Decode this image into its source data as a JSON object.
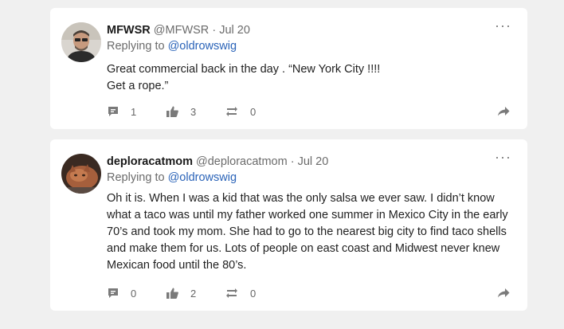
{
  "posts": [
    {
      "author": "MFWSR",
      "handle": "@MFWSR",
      "date": "Jul 20",
      "reply_prefix": "Replying to",
      "reply_to": "@oldrowswig",
      "body": [
        "Great commercial back in the day . “New York City !!!!",
        "Get a rope.”"
      ],
      "comments": "1",
      "likes": "3",
      "reposts": "0"
    },
    {
      "author": "deploracatmom",
      "handle": "@deploracatmom",
      "date": "Jul 20",
      "reply_prefix": "Replying to",
      "reply_to": "@oldrowswig",
      "body": [
        "Oh it is. When I was a kid that was the only salsa we ever saw. I didn’t know what a taco was until my father worked one summer in Mexico City in the early 70’s and took my mom. She had to go to the nearest big city to find taco shells and make them for us. Lots of people on east coast and Midwest never knew  Mexican food until the 80’s."
      ],
      "comments": "0",
      "likes": "2",
      "reposts": "0"
    }
  ],
  "separator": "·",
  "more_glyph": "···",
  "icons": {
    "comment": "comment-icon",
    "like": "thumbs-up-icon",
    "repost": "repost-icon",
    "share": "share-arrow-icon",
    "more": "more-options-icon"
  },
  "colors": {
    "background": "#f0f0f0",
    "card": "#ffffff",
    "link": "#2a63b8",
    "muted": "#6b6b6b"
  }
}
